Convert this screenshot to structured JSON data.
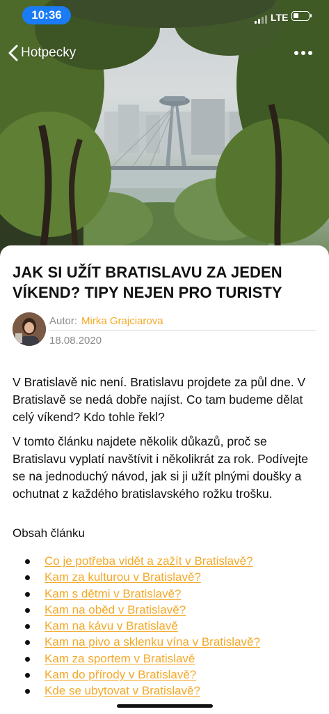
{
  "status_bar": {
    "time": "10:36",
    "network": "LTE",
    "accent": "#1a7cf5"
  },
  "nav": {
    "back_label": "Hotpecky",
    "back_icon": "chevron-left-icon",
    "more_icon": "more-dots-icon"
  },
  "hero": {
    "icon": "bratislava-photo"
  },
  "article": {
    "title": "JAK SI UŽÍT BRATISLAVU ZA JEDEN VÍKEND? TIPY NEJEN PRO TURISTY",
    "author_label": "Autor:",
    "author_name": "Mirka Grajciarova",
    "date": "18.08.2020",
    "paragraphs": [
      "V Bratislavě nic není. Bratislavu projdete za půl dne. V Bratislavě se nedá dobře najíst. Co tam budeme dělat celý víkend? Kdo tohle řekl?",
      "V tomto článku najdete několik důkazů, proč se Bratislavu vyplatí navštívit i několikrát za rok. Podívejte se na jednoduchý návod, jak si ji užít plnými doušky a ochutnat z každého bratislavského rožku trošku."
    ],
    "toc_heading": "Obsah článku",
    "toc": [
      "Co je potřeba vidět a zažít v Bratislavě?",
      "Kam za kulturou v Bratislavě?",
      "Kam s dětmi v Bratislavě?",
      "Kam na oběd v Bratislavě?",
      "Kam na kávu v Bratislavě",
      "Kam na pivo a sklenku vína v Bratislavě?",
      "Kam za sportem v Bratislavě",
      "Kam do přírody v Bratislavě?",
      "Kde se ubytovat v Bratislavě?"
    ],
    "link_color": "#f3a929"
  }
}
